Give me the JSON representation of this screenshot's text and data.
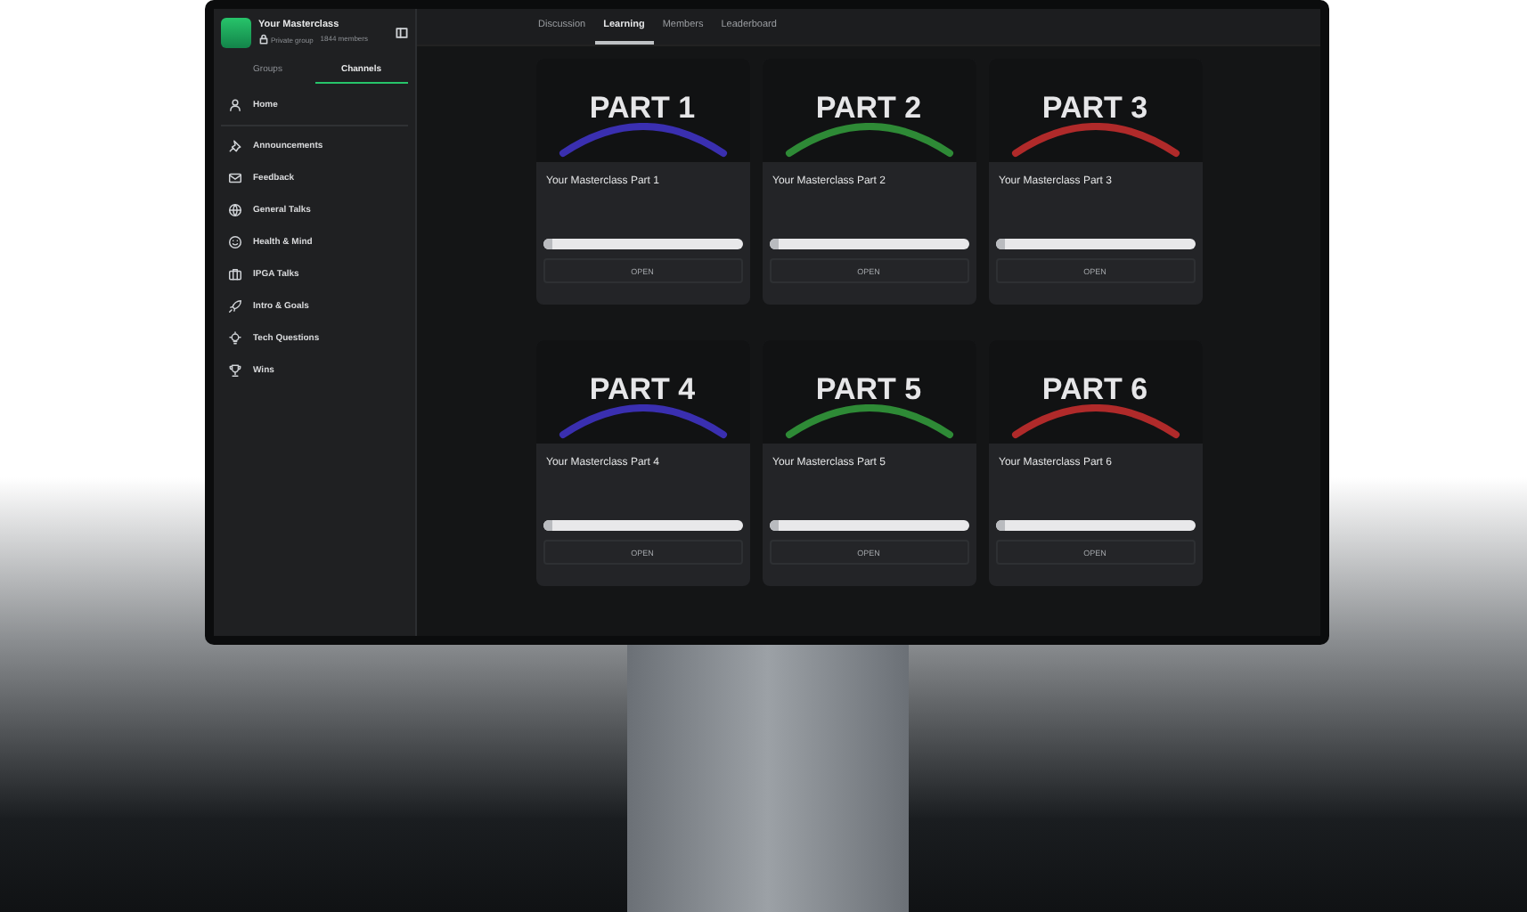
{
  "sidebar": {
    "group_title": "Your Masterclass",
    "privacy": "Private group",
    "members": "1844 members",
    "tabs": [
      {
        "label": "Groups",
        "selected": false
      },
      {
        "label": "Channels",
        "selected": true
      }
    ],
    "home": {
      "label": "Home"
    },
    "channels": [
      {
        "label": "Announcements"
      },
      {
        "label": "Feedback"
      },
      {
        "label": "General Talks"
      },
      {
        "label": "Health & Mind"
      },
      {
        "label": "IPGA Talks"
      },
      {
        "label": "Intro & Goals"
      },
      {
        "label": "Tech Questions"
      },
      {
        "label": "Wins"
      }
    ]
  },
  "nav": {
    "tabs": [
      {
        "label": "Discussion",
        "selected": false
      },
      {
        "label": "Learning",
        "selected": true
      },
      {
        "label": "Members",
        "selected": false
      },
      {
        "label": "Leaderboard",
        "selected": false
      }
    ]
  },
  "courses": [
    {
      "thumb_label": "PART 1",
      "color": "#3a2fb0",
      "title": "Your Masterclass Part 1",
      "level": 0.05,
      "button": "OPEN"
    },
    {
      "thumb_label": "PART 2",
      "color": "#2e8a36",
      "title": "Your Masterclass Part 2",
      "level": 0.05,
      "button": "OPEN"
    },
    {
      "thumb_label": "PART 3",
      "color": "#b02a2a",
      "title": "Your Masterclass Part 3",
      "level": 0.05,
      "button": "OPEN"
    },
    {
      "thumb_label": "PART 4",
      "color": "#3a2fb0",
      "title": "Your Masterclass Part 4",
      "level": 0.05,
      "button": "OPEN"
    },
    {
      "thumb_label": "PART 5",
      "color": "#2e8a36",
      "title": "Your Masterclass Part 5",
      "level": 0.05,
      "button": "OPEN"
    },
    {
      "thumb_label": "PART 6",
      "color": "#b02a2a",
      "title": "Your Masterclass Part 6",
      "level": 0.05,
      "button": "OPEN"
    }
  ]
}
